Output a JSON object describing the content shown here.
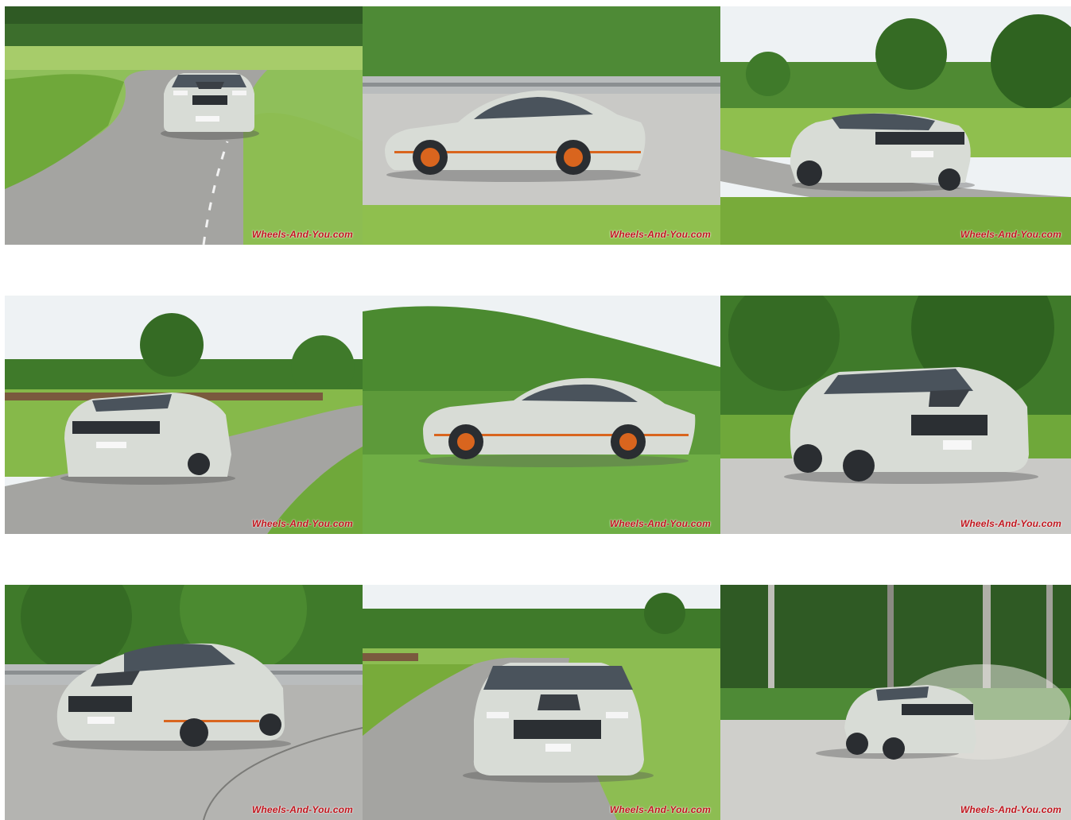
{
  "gallery": {
    "watermark": "Wheels-And-You.com",
    "photos": [
      {
        "name": "photo-1",
        "scene": "front-road-curve",
        "watermark": "Wheels-And-You.com"
      },
      {
        "name": "photo-2",
        "scene": "side-guardrail",
        "watermark": "Wheels-And-You.com"
      },
      {
        "name": "photo-3",
        "scene": "rear-quarter-field",
        "watermark": "Wheels-And-You.com"
      },
      {
        "name": "photo-4",
        "scene": "rear-road-field",
        "watermark": "Wheels-And-You.com"
      },
      {
        "name": "photo-5",
        "scene": "side-panning-grass",
        "watermark": "Wheels-And-You.com"
      },
      {
        "name": "photo-6",
        "scene": "front-quarter-gravel",
        "watermark": "Wheels-And-You.com"
      },
      {
        "name": "photo-7",
        "scene": "front-quarter-curve",
        "watermark": "Wheels-And-You.com"
      },
      {
        "name": "photo-8",
        "scene": "front-country-road",
        "watermark": "Wheels-And-You.com"
      },
      {
        "name": "photo-9",
        "scene": "drift-forest",
        "watermark": "Wheels-And-You.com"
      }
    ]
  },
  "colors": {
    "car_body": "#d8dcd6",
    "stripe_accent": "#d9651e",
    "hood_dark": "#3a3f45",
    "watermark_red": "#c0141c",
    "grass": "#7fb23c",
    "trees": "#3f7a2a",
    "road": "#a9a9a6",
    "sky": "#eef2f4"
  }
}
